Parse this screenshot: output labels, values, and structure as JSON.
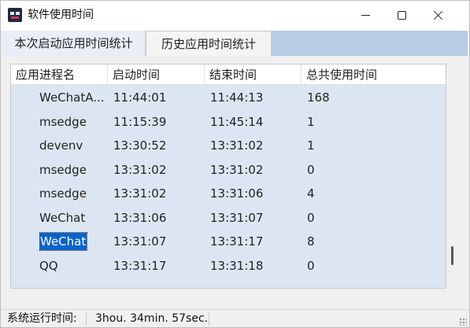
{
  "window": {
    "title": "软件使用时间",
    "icon": "app-robot-icon"
  },
  "tabs": [
    {
      "label": "本次启动应用时间统计",
      "active": false
    },
    {
      "label": "历史应用时间统计",
      "active": true
    }
  ],
  "table": {
    "columns": [
      "应用进程名",
      "启动时间",
      "结束时间",
      "总共使用时间"
    ],
    "rows": [
      {
        "name": "WeChatA...",
        "start": "11:44:01",
        "end": "11:44:13",
        "duration": "168"
      },
      {
        "name": "msedge",
        "start": "11:15:39",
        "end": "11:45:14",
        "duration": "1"
      },
      {
        "name": "devenv",
        "start": "13:30:52",
        "end": "13:31:02",
        "duration": "1"
      },
      {
        "name": "msedge",
        "start": "13:31:02",
        "end": "13:31:02",
        "duration": "0"
      },
      {
        "name": "msedge",
        "start": "13:31:02",
        "end": "13:31:06",
        "duration": "4"
      },
      {
        "name": "WeChat",
        "start": "13:31:06",
        "end": "13:31:07",
        "duration": "0"
      },
      {
        "name": "WeChat",
        "start": "13:31:07",
        "end": "13:31:17",
        "duration": "8",
        "selected": true
      },
      {
        "name": "QQ",
        "start": "13:31:17",
        "end": "13:31:18",
        "duration": "0"
      }
    ]
  },
  "status": {
    "label": "系统运行时间:",
    "value": "3hou. 34min. 57sec."
  },
  "colors": {
    "tabstrip": "#b8cce4",
    "list_background": "#dce6f2",
    "selection": "#0a64c8"
  }
}
